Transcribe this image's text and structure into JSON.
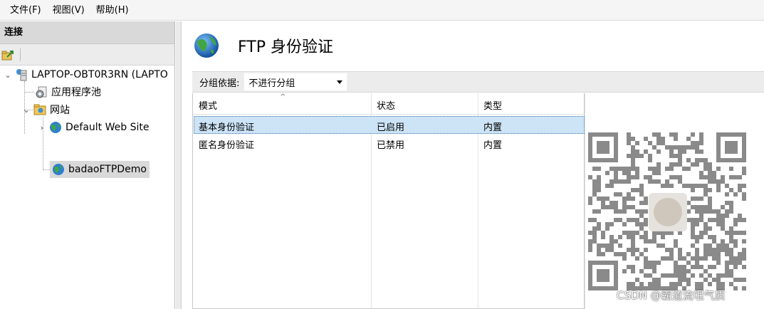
{
  "menubar": {
    "items": [
      "文件(F)",
      "视图(V)",
      "帮助(H)"
    ]
  },
  "connections": {
    "header": "连接",
    "tree": {
      "server": "LAPTOP-OBT0R3RN (LAPTO",
      "app_pools": "应用程序池",
      "sites": "网站",
      "site_default": "Default Web Site",
      "site_ftp": "badaoFTPDemo"
    }
  },
  "content": {
    "title": "FTP 身份验证",
    "group_by_label": "分组依据:",
    "group_by_value": "不进行分组",
    "columns": [
      "模式",
      "状态",
      "类型"
    ],
    "rows": [
      {
        "mode": "基本身份验证",
        "status": "已启用",
        "type": "内置"
      },
      {
        "mode": "匿名身份验证",
        "status": "已禁用",
        "type": "内置"
      }
    ]
  },
  "watermark": "CSDN @霸道流氓气质",
  "colors": {
    "selection": "#cde4f7",
    "header_bg": "#d9d9d9"
  }
}
